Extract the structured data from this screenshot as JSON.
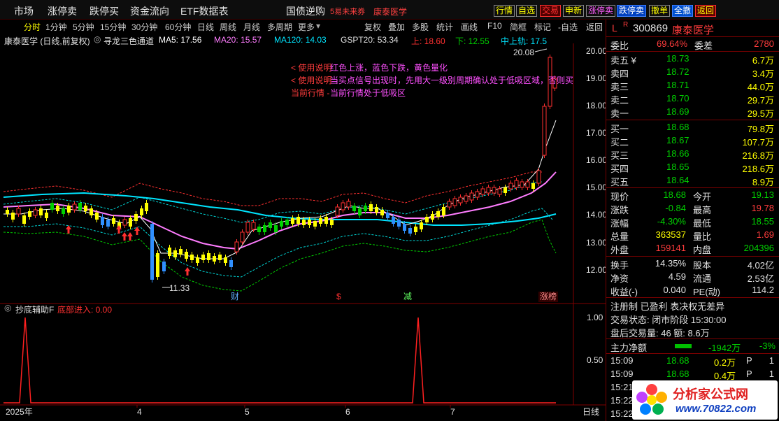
{
  "topbar": {
    "menu": [
      "市场",
      "涨停卖",
      "跌停买",
      "资金流向",
      "ETF数据表",
      "国债逆购"
    ],
    "marquee_1": "5易未来券",
    "marquee_2": "康泰医学",
    "buttons": [
      "行情",
      "自选",
      "交易",
      "申新",
      "涨停卖",
      "跌停卖",
      "撤单",
      "全撤",
      "返回"
    ]
  },
  "chart_header": {
    "stock": "康泰医学 (日线,前复权)",
    "indicator": "寻龙三色通道",
    "ma5": "MA5: 17.56",
    "ma20": "MA20: 15.57",
    "ma120": "MA120: 14.03",
    "gspt": "GSPT20: 53.34",
    "up": "上: 18.60",
    "down": "下: 12.55",
    "mid": "中上轨: 17.5"
  },
  "toolbar": {
    "left": [
      "分时",
      "1分钟",
      "5分钟",
      "15分钟",
      "30分钟",
      "60分钟",
      "日线",
      "周线",
      "月线",
      "多周期",
      "更多"
    ],
    "right": [
      "复权",
      "叠加",
      "多股",
      "统计",
      "画线",
      "F10",
      "简框",
      "标记",
      "-自选",
      "返回"
    ]
  },
  "notes": {
    "line1_a": "< 使用说明",
    "line1_b": "红色上涨，蓝色下跌，黄色量化",
    "line2_a": "< 使用说明",
    "line2_b": "当买点信号出现时，先用大一级别周期确认处于低吸区域，否则买",
    "line3_a": "当前行情 -",
    "line3_b": "当前行情处于低吸区"
  },
  "price_axis": [
    "20.00",
    "19.00",
    "18.00",
    "17.00",
    "16.00",
    "15.00",
    "14.00",
    "13.00",
    "12.00"
  ],
  "high_label": "20.08",
  "low_label": "11.33",
  "event_marks": [
    "财",
    "$",
    "减",
    "涨榜"
  ],
  "sub_header": {
    "name": "抄底辅助F",
    "value": "底部进入: 0.00"
  },
  "sub_axis": [
    "1.00",
    "0.50"
  ],
  "date_axis": [
    "2025年",
    "4",
    "5",
    "6",
    "7"
  ],
  "period_label": "日线",
  "quote": {
    "flag": "L",
    "r_flag": "R",
    "code": "300869",
    "name": "康泰医学",
    "weibi_label": "委比",
    "weibi": "69.64%",
    "weicha_label": "委差",
    "weicha": "2780",
    "sell": [
      {
        "label": "卖五 ¥",
        "price": "18.73",
        "vol": "6.7万"
      },
      {
        "label": "卖四",
        "price": "18.72",
        "vol": "3.4万"
      },
      {
        "label": "卖三",
        "price": "18.71",
        "vol": "44.0万"
      },
      {
        "label": "卖二",
        "price": "18.70",
        "vol": "29.7万"
      },
      {
        "label": "卖一",
        "price": "18.69",
        "vol": "29.5万"
      }
    ],
    "buy": [
      {
        "label": "买一",
        "price": "18.68",
        "vol": "79.8万"
      },
      {
        "label": "买二",
        "price": "18.67",
        "vol": "107.7万"
      },
      {
        "label": "买三",
        "price": "18.66",
        "vol": "216.8万"
      },
      {
        "label": "买四",
        "price": "18.65",
        "vol": "218.6万"
      },
      {
        "label": "买五",
        "price": "18.64",
        "vol": "8.9万"
      }
    ],
    "stats": [
      {
        "l1": "现价",
        "v1": "18.68",
        "c1": "green",
        "l2": "今开",
        "v2": "19.13",
        "c2": "green"
      },
      {
        "l1": "涨跌",
        "v1": "-0.84",
        "c1": "green",
        "l2": "最高",
        "v2": "19.78",
        "c2": "red"
      },
      {
        "l1": "涨幅",
        "v1": "-4.30%",
        "c1": "green",
        "l2": "最低",
        "v2": "18.55",
        "c2": "green"
      },
      {
        "l1": "总量",
        "v1": "363537",
        "c1": "yellow",
        "l2": "量比",
        "v2": "1.69",
        "c2": "red"
      },
      {
        "l1": "外盘",
        "v1": "159141",
        "c1": "red",
        "l2": "内盘",
        "v2": "204396",
        "c2": "green"
      }
    ],
    "stats2": [
      {
        "l1": "换手",
        "v1": "14.35%",
        "l2": "股本",
        "v2": "4.02亿"
      },
      {
        "l1": "净资",
        "v1": "4.59",
        "l2": "流通",
        "v2": "2.53亿"
      },
      {
        "l1": "收益(-)",
        "v1": "0.040",
        "l2": "PE(动)",
        "v2": "114.2"
      }
    ],
    "reg": "注册制 已盈利 表决权无差异",
    "trade_state": "交易状态: 闭市阶段 15:30:00",
    "after_hours": "盘后交易量: 46  额: 8.6万",
    "net_flow_label": "主力净额",
    "net_flow": "-1942万",
    "net_flow_pct": "-3%",
    "ticks": [
      {
        "time": "15:09",
        "price": "18.68",
        "vol": "0.2万",
        "side": "P",
        "n": "1"
      },
      {
        "time": "15:09",
        "price": "18.68",
        "vol": "0.4万",
        "side": "P",
        "n": "1"
      },
      {
        "time": "15:21",
        "price": "",
        "vol": "",
        "side": "",
        "n": ""
      },
      {
        "time": "15:22",
        "price": "",
        "vol": "",
        "side": "",
        "n": ""
      },
      {
        "time": "15:22",
        "price": "",
        "vol": "",
        "side": "",
        "n": ""
      }
    ]
  },
  "watermark": {
    "title": "分析家公式网",
    "url": "www.70822.com"
  },
  "colors": {
    "up": "#ff3c3c",
    "down": "#00d000",
    "ma_white": "#ffffff",
    "ma_magenta": "#ff7cff",
    "ma_cyan": "#00e5ff",
    "channel_red": "#ff3030",
    "channel_cyan": "#00d5d5",
    "channel_green": "#00cc00"
  }
}
